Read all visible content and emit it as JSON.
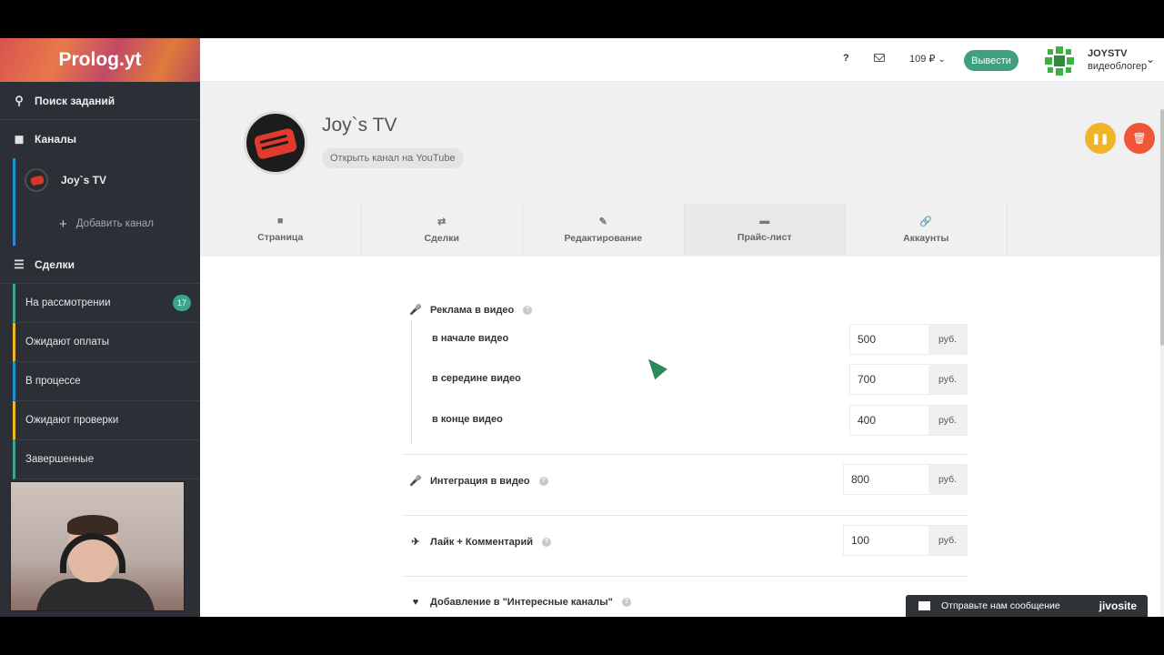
{
  "sidebar": {
    "logo": "Prolog.yt",
    "search": "Поиск заданий",
    "channels_title": "Каналы",
    "channel_name": "Joy`s TV",
    "add_channel": "Добавить канал",
    "deals_title": "Сделки",
    "deals": [
      {
        "label": "На рассмотрении",
        "badge": "17",
        "color": "#3aa58a"
      },
      {
        "label": "Ожидают оплаты",
        "color": "#f0b429"
      },
      {
        "label": "В процессе",
        "color": "#1f8fd6"
      },
      {
        "label": "Ожидают проверки",
        "color": "#f0b429"
      },
      {
        "label": "Завершенные",
        "color": "#3aa58a"
      }
    ]
  },
  "topbar": {
    "help": "?",
    "balance": "109 ₽",
    "withdraw": "Вывести",
    "user_name": "JOYSTV",
    "user_role": "видеоблогер"
  },
  "channel": {
    "name": "Joy`s TV",
    "youtube_link": "Открыть канал на YouTube"
  },
  "tabs": [
    {
      "label": "Страница",
      "icon": "camera-icon"
    },
    {
      "label": "Сделки",
      "icon": "swap-icon"
    },
    {
      "label": "Редактирование",
      "icon": "edit-icon"
    },
    {
      "label": "Прайс-лист",
      "icon": "card-icon"
    },
    {
      "label": "Аккаунты",
      "icon": "link-icon"
    }
  ],
  "pricelist": {
    "ad": {
      "title": "Реклама в видео",
      "items": [
        {
          "label": "в начале видео",
          "value": "500",
          "unit": "руб."
        },
        {
          "label": "в середине видео",
          "value": "700",
          "unit": "руб."
        },
        {
          "label": "в конце видео",
          "value": "400",
          "unit": "руб."
        }
      ]
    },
    "integration": {
      "title": "Интеграция в видео",
      "value": "800",
      "unit": "руб."
    },
    "like": {
      "title": "Лайк + Комментарий",
      "value": "100",
      "unit": "руб."
    },
    "interesting": {
      "title": "Добавление в \"Интересные каналы\""
    }
  },
  "chat": {
    "label": "Отправьте нам сообщение",
    "brand": "jivosite"
  },
  "colors": {
    "accent_green": "#3f9f7e",
    "pause": "#f0b429",
    "delete": "#f0573a",
    "sidebar_bg": "#2c3036"
  }
}
